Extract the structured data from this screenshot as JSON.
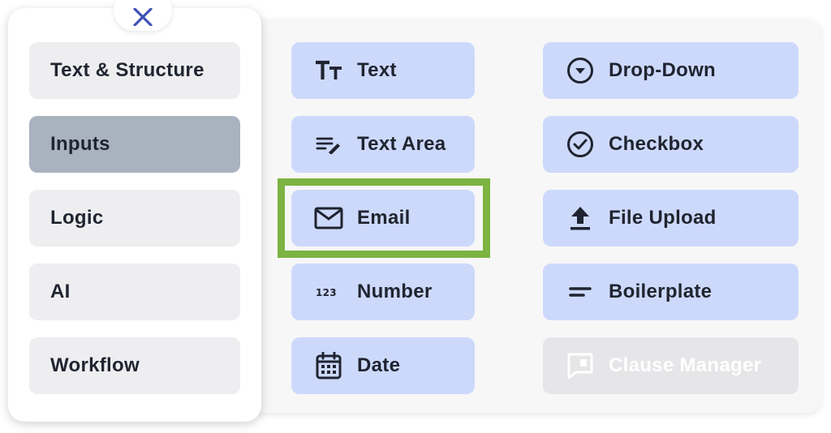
{
  "categories": [
    {
      "label": "Text & Structure"
    },
    {
      "label": "Inputs"
    },
    {
      "label": "Logic"
    },
    {
      "label": "AI"
    },
    {
      "label": "Workflow"
    }
  ],
  "active_category": "Inputs",
  "inputs": {
    "text": {
      "label": "Text",
      "icon": "text-size-icon"
    },
    "text_area": {
      "label": "Text Area",
      "icon": "text-area-icon"
    },
    "email": {
      "label": "Email",
      "icon": "envelope-icon"
    },
    "number": {
      "label": "Number",
      "icon": "numbers-123-icon"
    },
    "date": {
      "label": "Date",
      "icon": "calendar-icon"
    },
    "dropdown": {
      "label": "Drop-Down",
      "icon": "chevron-circle-icon"
    },
    "checkbox": {
      "label": "Checkbox",
      "icon": "check-circle-icon"
    },
    "file_upload": {
      "label": "File Upload",
      "icon": "upload-icon"
    },
    "boilerplate": {
      "label": "Boilerplate",
      "icon": "boilerplate-icon"
    },
    "clause_manager": {
      "label": "Clause Manager",
      "icon": "clause-icon",
      "disabled": true
    }
  },
  "colors": {
    "button_bg": "#cdd9fb",
    "active_category_bg": "#a9b2bf",
    "category_bg": "#eeeef0",
    "highlight": "#7cb342",
    "close_icon": "#3f51b5"
  }
}
